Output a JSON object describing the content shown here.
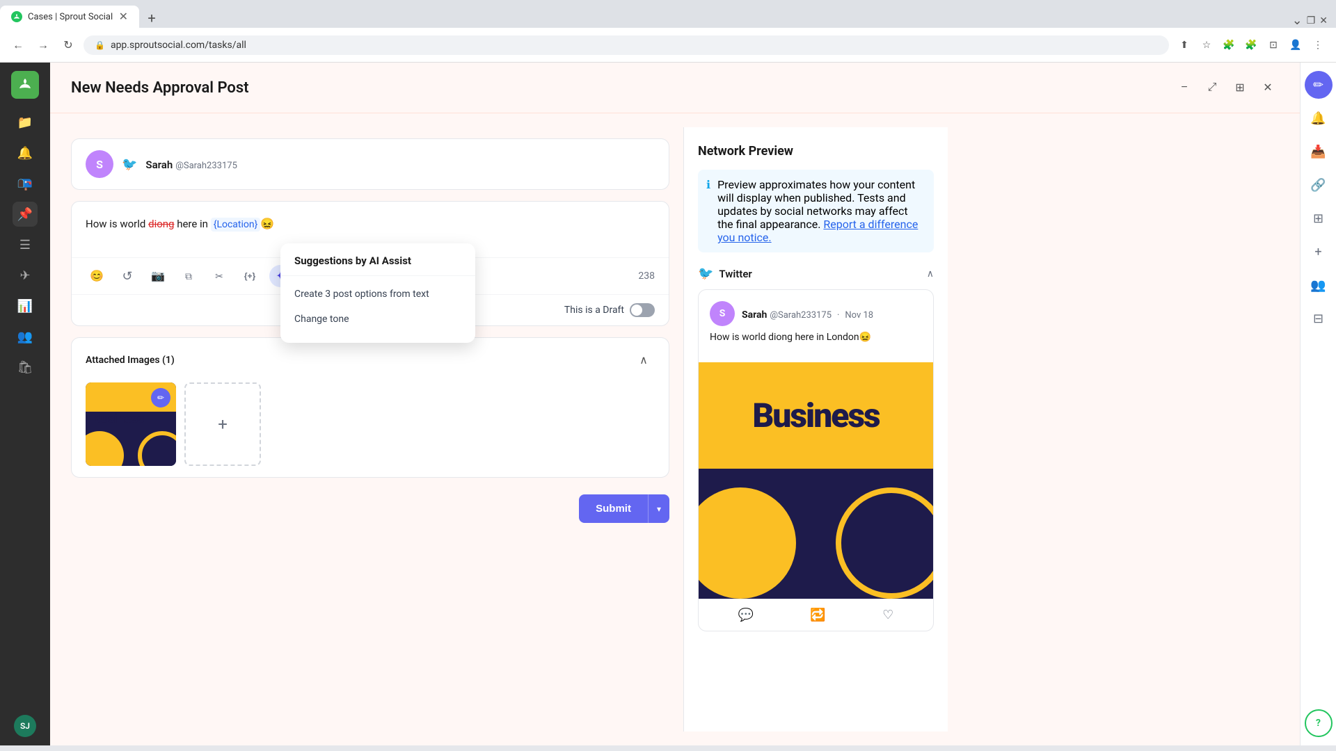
{
  "browser": {
    "tab_title": "Cases | Sprout Social",
    "tab_favicon": "🌿",
    "address": "app.sproutsocial.com/tasks/all",
    "new_tab_label": "+"
  },
  "header": {
    "title": "New Needs Approval Post",
    "minimize_label": "−",
    "expand_label": "⤢",
    "grid_label": "⊞",
    "close_label": "✕"
  },
  "account": {
    "name": "Sarah",
    "handle": "@Sarah233175",
    "platform": "Twitter"
  },
  "editor": {
    "text_before": "How is world ",
    "text_strikethrough": "diong",
    "text_middle": " here in ",
    "text_variable": "{Location}",
    "text_emoji": "😖",
    "char_count": "238",
    "draft_label": "This is a Draft"
  },
  "toolbar": {
    "emoji_label": "😊",
    "regenerate_label": "↺",
    "camera_label": "📷",
    "copy_label": "⧉",
    "scissors_label": "✂",
    "variables_label": "{+}",
    "ai_assist_label": "✦"
  },
  "ai_dropdown": {
    "title": "Suggestions by AI Assist",
    "item1": "Create 3 post options from text",
    "item2": "Change tone"
  },
  "attached_images": {
    "label": "Attached Images (1)"
  },
  "submit": {
    "label": "Submit",
    "dropdown_icon": "▾"
  },
  "network_preview": {
    "title": "Network Preview",
    "info_text": "Preview approximates how your content will display when published. Tests and updates by social networks may affect the final appearance. ",
    "info_link": "Report a difference you notice.",
    "twitter_label": "Twitter",
    "tweet_author": "Sarah",
    "tweet_handle": "@Sarah233175",
    "tweet_date": "Nov 18",
    "tweet_text": "How is world diong here in London😖"
  },
  "sidebar": {
    "logo": "🌿",
    "items": [
      {
        "icon": "📁",
        "name": "files",
        "active": false
      },
      {
        "icon": "🔔",
        "name": "notifications",
        "active": false
      },
      {
        "icon": "📭",
        "name": "inbox",
        "active": false
      },
      {
        "icon": "📌",
        "name": "pinned",
        "active": true
      },
      {
        "icon": "☰",
        "name": "list",
        "active": false
      },
      {
        "icon": "✈",
        "name": "publish",
        "active": false
      },
      {
        "icon": "📊",
        "name": "analytics",
        "active": false
      },
      {
        "icon": "👥",
        "name": "users",
        "active": false
      },
      {
        "icon": "🛍",
        "name": "commerce",
        "active": false
      }
    ],
    "user_initials": "SJ"
  },
  "right_panel": {
    "compose_icon": "✏",
    "bell_icon": "🔔",
    "inbox_icon": "📥",
    "link_icon": "🔗",
    "grid_icon": "⊞",
    "add_icon": "+",
    "users_icon": "👥",
    "table_icon": "⊟",
    "help_icon": "?"
  }
}
